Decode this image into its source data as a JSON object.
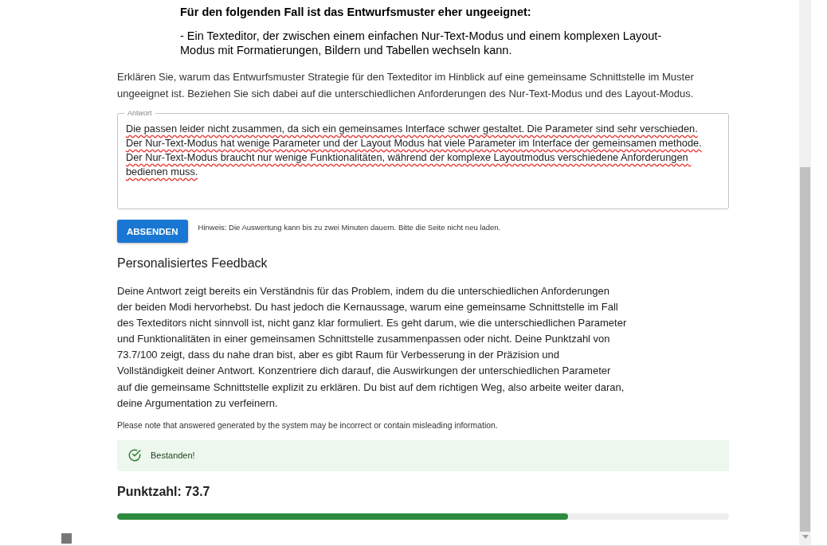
{
  "question": {
    "heading": "Für den folgenden Fall ist das Entwurfsmuster eher ungeeignet:",
    "case": "- Ein Texteditor, der zwischen einem einfachen Nur-Text-Modus und einem komplexen Layout-Modus mit Formatierungen, Bildern und Tabellen wechseln kann.",
    "prompt": "Erklären Sie, warum das Entwurfsmuster Strategie für den Texteditor im Hinblick auf eine gemeinsame Schnittstelle im Muster ungeeignet ist. Beziehen Sie sich dabei auf die unterschiedlichen Anforderungen des Nur-Text-Modus und des Layout-Modus."
  },
  "answer": {
    "label": "Antwort",
    "value": "Die passen leider nicht zusammen, da sich ein gemeinsames Interface schwer gestaltet. Die Parameter sind sehr verschieden.\nDer Nur-Text-Modus hat wenige Parameter und der Layout Modus hat viele Parameter im Interface der gemeinsamen methode.\nDer Nur-Text-Modus braucht nur wenige Funktionalitäten, während der komplexe Layoutmodus verschiedene Anforderungen bedienen muss."
  },
  "submit": {
    "label": "ABSENDEN",
    "hint": "Hinweis: Die Auswertung kann bis zu zwei Minuten dauern. Bitte die Seite nicht neu laden."
  },
  "feedback": {
    "title": "Personalisiertes Feedback",
    "text": "Deine Antwort zeigt bereits ein Verständnis für das Problem, indem du die unterschiedlichen Anforderungen der beiden Modi hervorhebst. Du hast jedoch die Kernaussage, warum eine gemeinsame Schnittstelle im Fall des Texteditors nicht sinnvoll ist, nicht ganz klar formuliert. Es geht darum, wie die unterschiedlichen Parameter und Funktionalitäten in einer gemeinsamen Schnittstelle zusammenpassen oder nicht. Deine Punktzahl von 73.7/100 zeigt, dass du nahe dran bist, aber es gibt Raum für Verbesserung in der Präzision und Vollständigkeit deiner Antwort. Konzentriere dich darauf, die Auswirkungen der unterschiedlichen Parameter auf die gemeinsame Schnittstelle explizit zu erklären. Du bist auf dem richtigen Weg, also arbeite weiter daran, deine Argumentation zu verfeinern.",
    "disclaimer": "Please note that answered generated by the system may be incorrect or contain misleading information."
  },
  "result": {
    "passed": true,
    "label": "Bestanden!"
  },
  "score": {
    "label": "Punktzahl: 73.7",
    "level": 0.737
  }
}
